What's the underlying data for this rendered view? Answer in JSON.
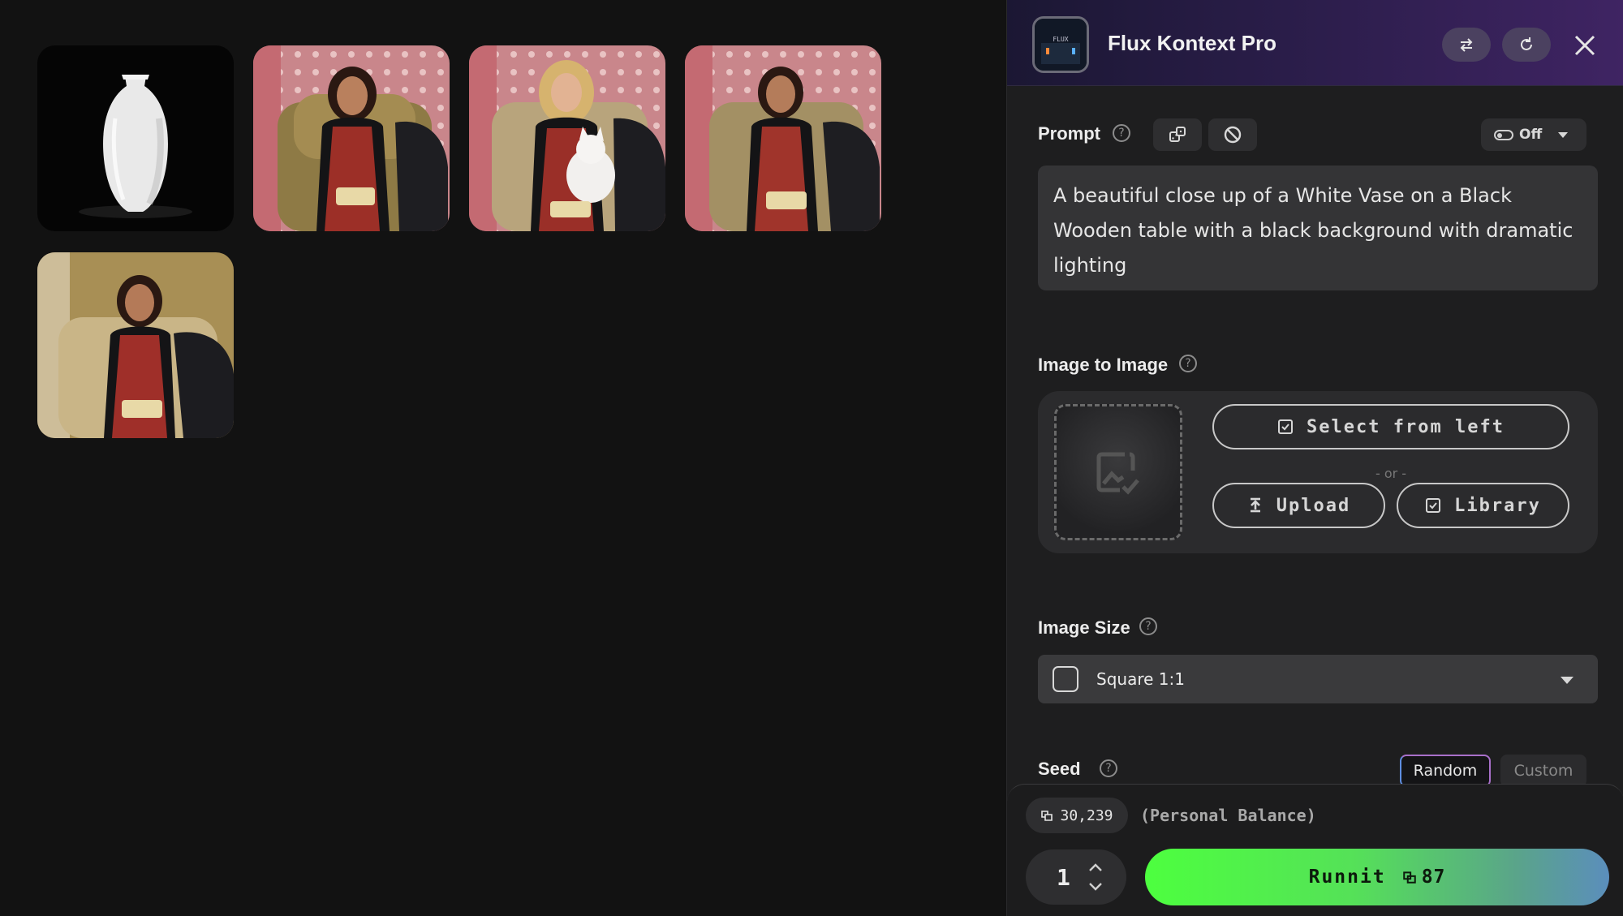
{
  "panel": {
    "title": "Flux Kontext Pro",
    "avatar_text": "FLUX"
  },
  "prompt": {
    "label": "Prompt",
    "help": "?",
    "toggle_label": "Off",
    "text": "A beautiful close up of a White Vase on a Black Wooden table with a black background with dramatic lighting"
  },
  "image_to_image": {
    "label": "Image to Image",
    "help": "?",
    "select_label": "Select from left",
    "or_text": "- or -",
    "upload_label": "Upload",
    "library_label": "Library"
  },
  "image_size": {
    "label": "Image Size",
    "help": "?",
    "value": "Square 1:1"
  },
  "seed": {
    "label": "Seed",
    "help": "?",
    "options": [
      "Random",
      "Custom"
    ],
    "selected": "Random"
  },
  "footer": {
    "balance": "30,239",
    "balance_label": "(Personal Balance)",
    "quantity": "1",
    "run_label": "Runnit",
    "run_cost": "87"
  },
  "gallery": {
    "images": [
      {
        "subject": "white-vase"
      },
      {
        "subject": "woman-armchair"
      },
      {
        "subject": "woman-with-cat"
      },
      {
        "subject": "woman-armchair"
      },
      {
        "subject": "woman-armchair-beige"
      }
    ]
  },
  "colors": {
    "accent_green": "#4dff3f",
    "accent_blue": "#5b8ebc",
    "header_purple": "#3f2463",
    "panel_bg": "#1e1e1f"
  }
}
